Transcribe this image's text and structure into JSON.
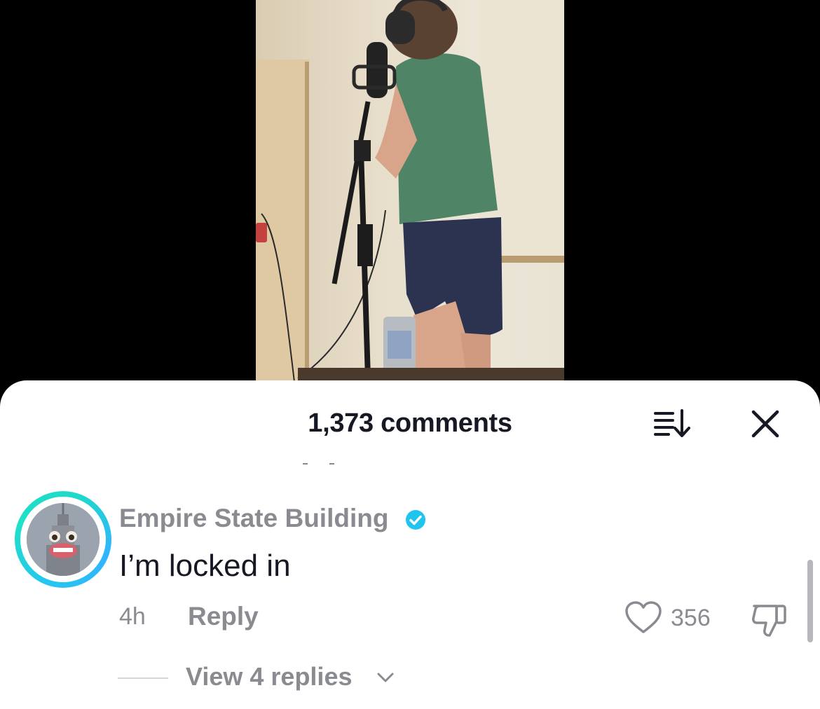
{
  "comments_sheet": {
    "title": "1,373 comments",
    "sort_icon": "sort-descending-icon",
    "close_icon": "close-icon"
  },
  "comment": {
    "author": "Empire State Building",
    "verified_icon": "verified-badge-icon",
    "text": "I’m locked in",
    "time": "4h",
    "reply_label": "Reply",
    "like_icon": "heart-outline-icon",
    "like_count": "356",
    "dislike_icon": "thumbs-down-icon",
    "view_replies_label": "View 4 replies",
    "view_replies_icon": "chevron-down-icon"
  },
  "colors": {
    "verified": "#20C4EE",
    "ring_start": "#25C6F0",
    "ring_end": "#1FE0C8",
    "muted_text": "#8A8B91",
    "primary_text": "#161823"
  }
}
